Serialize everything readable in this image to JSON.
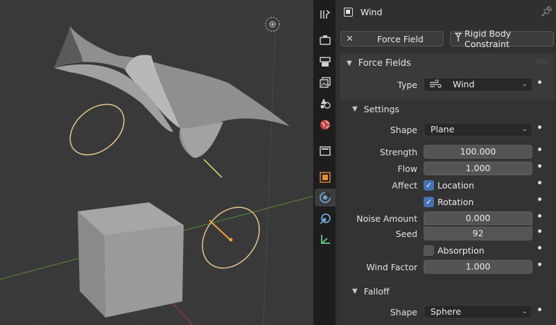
{
  "header": {
    "object_icon": "object-square-icon",
    "object_name": "Wind",
    "pin_icon": "pin-icon"
  },
  "buttons": {
    "force_field": "Force Field",
    "rigid_body_constraint": "Rigid Body Constraint"
  },
  "tabs": [
    {
      "name": "tool-tab-icon"
    },
    {
      "name": "render-tab-icon"
    },
    {
      "name": "output-tab-icon"
    },
    {
      "name": "view-layer-tab-icon"
    },
    {
      "name": "scene-tab-icon"
    },
    {
      "name": "world-tab-icon"
    },
    {
      "name": "collection-tab-icon"
    },
    {
      "name": "object-tab-icon"
    },
    {
      "name": "physics-tab-icon",
      "active": true
    },
    {
      "name": "object-constraint-tab-icon"
    },
    {
      "name": "object-data-tab-icon"
    }
  ],
  "force_fields": {
    "title": "Force Fields",
    "type_label": "Type",
    "type_value": "Wind",
    "type_icon": "wind-icon",
    "settings": {
      "title": "Settings",
      "shape_label": "Shape",
      "shape_value": "Plane",
      "strength_label": "Strength",
      "strength_value": "100.000",
      "flow_label": "Flow",
      "flow_value": "1.000",
      "affect_label": "Affect",
      "location_label": "Location",
      "location_checked": true,
      "rotation_label": "Rotation",
      "rotation_checked": true,
      "noise_label": "Noise Amount",
      "noise_value": "0.000",
      "seed_label": "Seed",
      "seed_value": "92",
      "absorption_label": "Absorption",
      "absorption_checked": false,
      "wind_factor_label": "Wind Factor",
      "wind_factor_value": "1.000"
    },
    "falloff": {
      "title": "Falloff",
      "shape_label": "Shape",
      "shape_value": "Sphere"
    }
  },
  "colors": {
    "accent": "#4772b3",
    "viewport_bg": "#393939",
    "empty_selected": "#e8c890"
  }
}
